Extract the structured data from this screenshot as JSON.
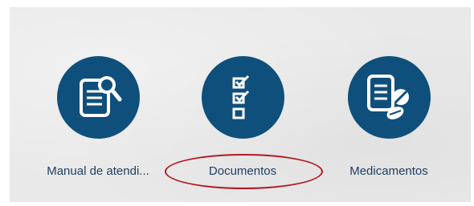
{
  "tiles": [
    {
      "label": "Manual de atendi...",
      "icon": "document-magnifier-icon"
    },
    {
      "label": "Documentos",
      "icon": "checklist-icon"
    },
    {
      "label": "Medicamentos",
      "icon": "document-pills-icon"
    }
  ],
  "colors": {
    "circle": "#0f4f7c",
    "label": "#1f3f63",
    "highlight": "#b3191e",
    "panel": "#e9e9e9"
  }
}
